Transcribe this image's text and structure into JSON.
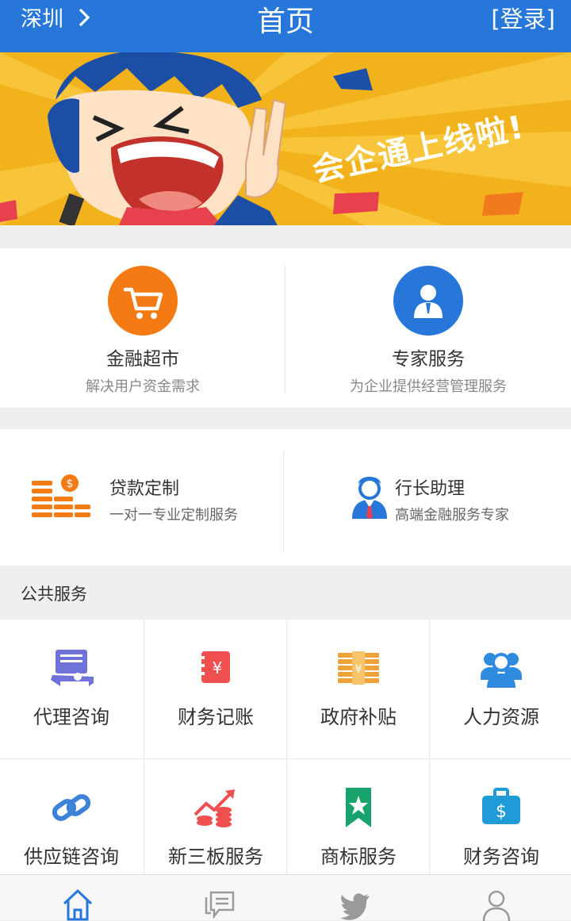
{
  "header": {
    "city": "深圳",
    "title": "首页",
    "login": "[登录]"
  },
  "banner": {
    "slogan": "会企通上线啦!"
  },
  "features": [
    {
      "title": "金融超市",
      "subtitle": "解决用户资金需求",
      "icon": "shopping-cart-icon",
      "color": "#f47a14"
    },
    {
      "title": "专家服务",
      "subtitle": "为企业提供经营管理服务",
      "icon": "expert-person-icon",
      "color": "#2677d9"
    }
  ],
  "services": [
    {
      "title": "贷款定制",
      "subtitle": "一对一专业定制服务",
      "icon": "money-stack-icon"
    },
    {
      "title": "行长助理",
      "subtitle": "高端金融服务专家",
      "icon": "manager-icon"
    }
  ],
  "public_services": {
    "heading": "公共服务",
    "items": [
      {
        "label": "代理咨询",
        "icon": "agent-consult-icon"
      },
      {
        "label": "财务记账",
        "icon": "ledger-icon"
      },
      {
        "label": "政府补贴",
        "icon": "subsidy-icon"
      },
      {
        "label": "人力资源",
        "icon": "people-icon"
      },
      {
        "label": "供应链咨询",
        "icon": "chain-link-icon"
      },
      {
        "label": "新三板服务",
        "icon": "growth-chart-icon"
      },
      {
        "label": "商标服务",
        "icon": "bookmark-star-icon"
      },
      {
        "label": "财务咨询",
        "icon": "money-bag-icon"
      }
    ]
  },
  "tabbar": [
    "home-icon",
    "message-icon",
    "bird-icon",
    "user-icon"
  ]
}
